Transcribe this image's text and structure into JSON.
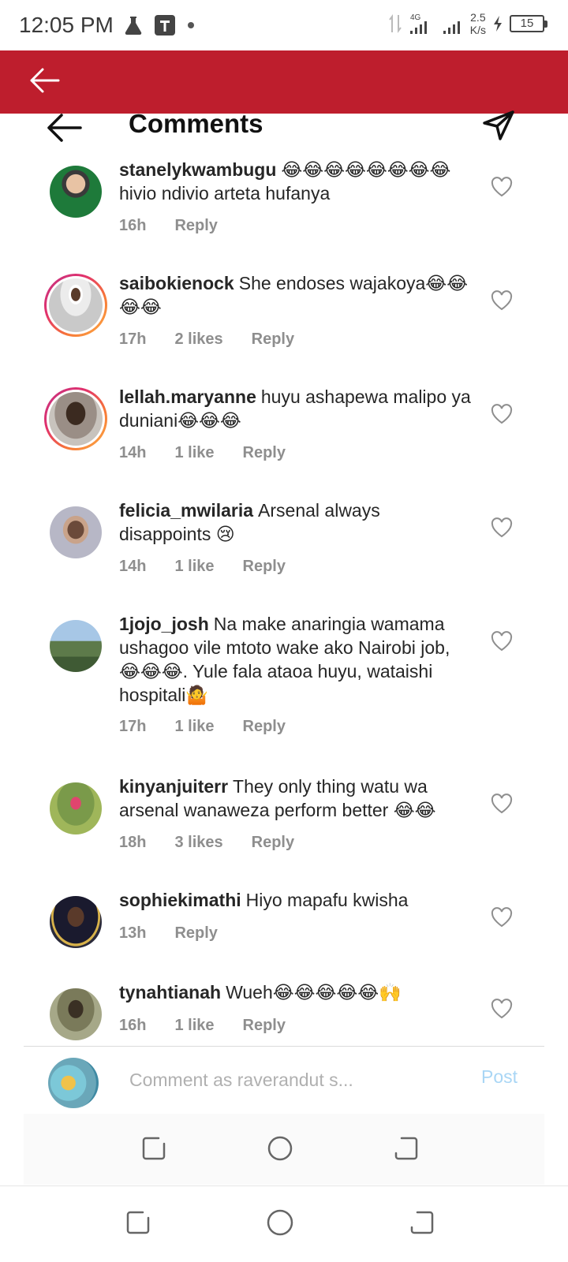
{
  "status_bar": {
    "time": "12:05 PM",
    "network": "4G",
    "speed_value": "2.5",
    "speed_unit": "K/s",
    "battery": "15"
  },
  "header": {
    "title": "Comments",
    "accent_color": "#be1e2d"
  },
  "comments": [
    {
      "username": "stanelykwambugu",
      "text": "😂😂😂😂😂😂😂😂hivio ndivio arteta hufanya",
      "time": "16h",
      "likes": "",
      "reply": "Reply"
    },
    {
      "username": "saibokienock",
      "text": "She endoses wajakoya😂😂😂😂",
      "time": "17h",
      "likes": "2 likes",
      "reply": "Reply"
    },
    {
      "username": "lellah.maryanne",
      "text": "huyu ashapewa malipo ya duniani😂😂😂",
      "time": "14h",
      "likes": "1 like",
      "reply": "Reply"
    },
    {
      "username": "felicia_mwilaria",
      "text": "Arsenal always disappoints 😢",
      "time": "14h",
      "likes": "1 like",
      "reply": "Reply"
    },
    {
      "username": "1jojo_josh",
      "text": "Na make anaringia wamama ushagoo vile mtoto wake ako Nairobi job, 😂😂😂. Yule fala ataoa huyu, wataishi hospitali🤷",
      "time": "17h",
      "likes": "1 like",
      "reply": "Reply"
    },
    {
      "username": "kinyanjuiterr",
      "text": "They only thing watu wa arsenal wanaweza perform better 😂😂",
      "time": "18h",
      "likes": "3 likes",
      "reply": "Reply"
    },
    {
      "username": "sophiekimathi",
      "text": "Hiyo mapafu kwisha",
      "time": "13h",
      "likes": "",
      "reply": "Reply"
    },
    {
      "username": "tynahtianah",
      "text": "Wueh😂😂😂😂😂🙌",
      "time": "16h",
      "likes": "1 like",
      "reply": "Reply"
    }
  ],
  "composer": {
    "placeholder": "Comment as raverandut s...",
    "post_label": "Post"
  },
  "icons": {
    "back": "arrow-left-icon",
    "share": "paper-plane-icon",
    "like": "heart-outline-icon",
    "nav_back": "back-nav-icon",
    "nav_home": "home-circle-icon",
    "nav_recent": "recents-icon"
  }
}
